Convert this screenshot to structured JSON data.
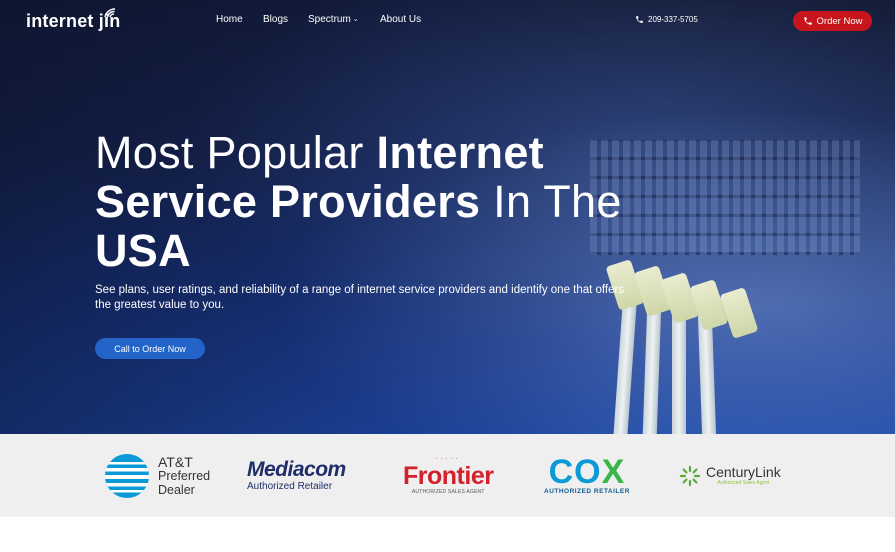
{
  "header": {
    "logo_text": "internet jin",
    "nav": [
      {
        "label": "Home"
      },
      {
        "label": "Blogs"
      },
      {
        "label": "Spectrum"
      },
      {
        "label": "About Us"
      }
    ],
    "phone": "209-337-5705",
    "order_button": "Order Now"
  },
  "hero": {
    "headline_part1": "Most Popular ",
    "headline_part2": "Internet Service Providers",
    "headline_part3": " In The ",
    "headline_part4": "USA",
    "subtext": "See plans, user ratings, and reliability of a range of internet service providers and identify one that offers the greatest value to you.",
    "cta_button": "Call to Order Now"
  },
  "partners": {
    "att": {
      "name": "AT&T",
      "line2": "Preferred",
      "line3": "Dealer"
    },
    "mediacom": {
      "name": "Mediacom",
      "sub": "Authorized Retailer"
    },
    "frontier": {
      "name": "Frontier",
      "sub": "AUTHORIZED SALES AGENT"
    },
    "cox": {
      "name_co": "CO",
      "name_x": "X",
      "sub": "AUTHORIZED RETAILER"
    },
    "centurylink": {
      "name": "CenturyLink",
      "sub": "Authorized Sales Agent"
    }
  },
  "colors": {
    "order_button": "#c8151b",
    "cta_button": "#2364c8",
    "partner_strip": "#efefef"
  }
}
